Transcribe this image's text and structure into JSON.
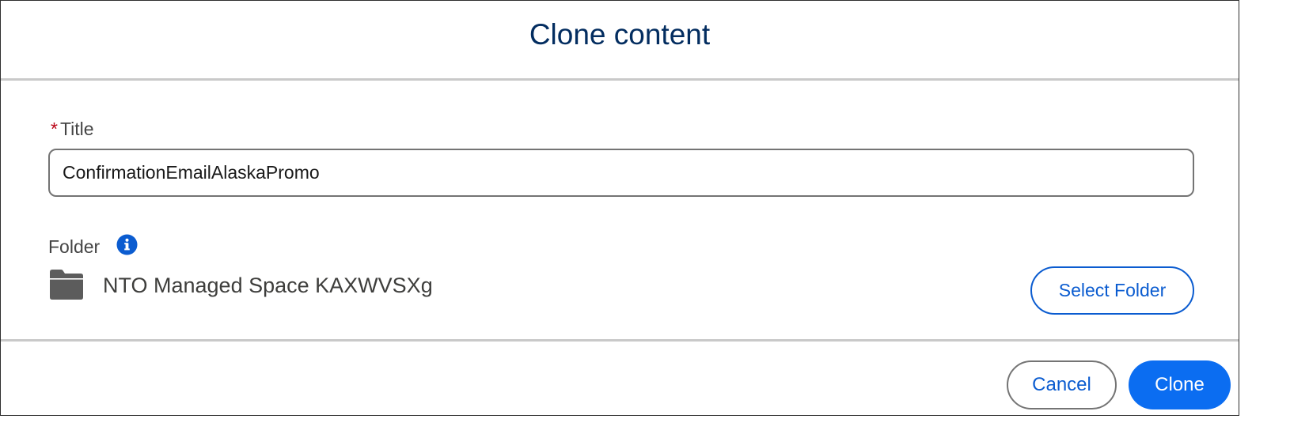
{
  "modal": {
    "title": "Clone content"
  },
  "form": {
    "title_field": {
      "required_mark": "*",
      "label": "Title",
      "value": "ConfirmationEmailAlaskaPromo"
    },
    "folder": {
      "label": "Folder",
      "info_icon": "info-icon",
      "folder_icon": "folder-icon",
      "name": "NTO Managed Space KAXWVSXg",
      "select_button_label": "Select Folder"
    }
  },
  "footer": {
    "cancel_label": "Cancel",
    "clone_label": "Clone"
  },
  "colors": {
    "brand": "#0b6df1",
    "title_text": "#032d60",
    "required": "#ba0517",
    "link": "#0b5cd0"
  }
}
